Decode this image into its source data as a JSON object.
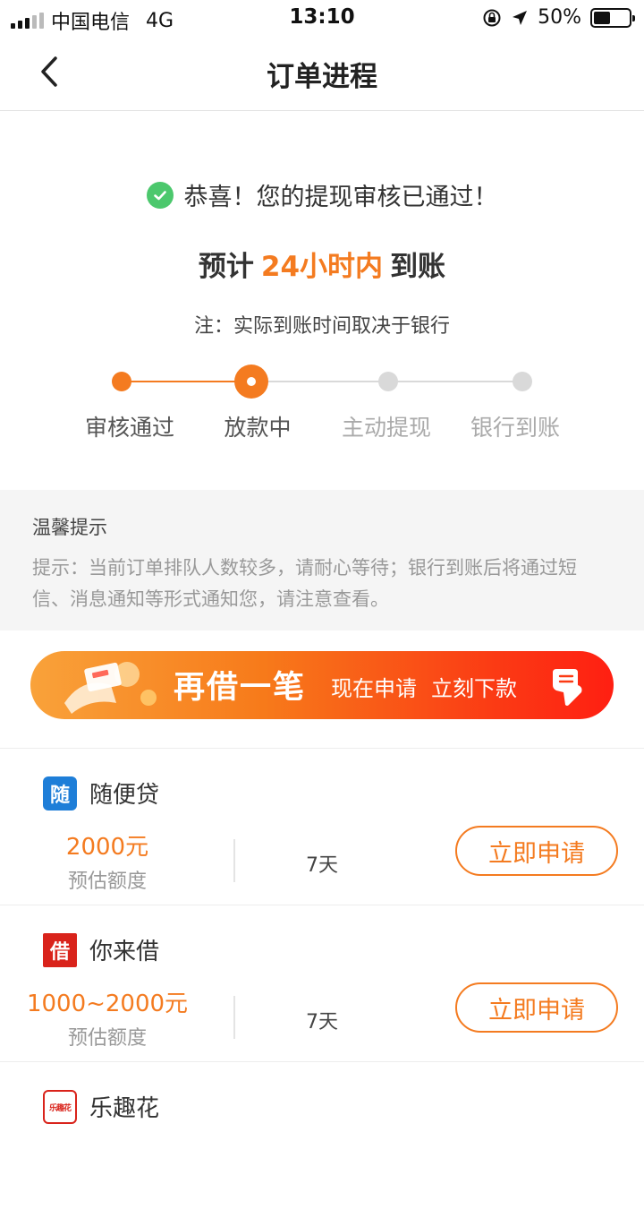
{
  "status_bar": {
    "carrier": "中国电信",
    "network": "4G",
    "time": "13:10",
    "battery": "50%",
    "battery_level": 0.5
  },
  "nav": {
    "title": "订单进程",
    "back_icon": "chevron-left-icon"
  },
  "hero": {
    "success_text": "恭喜！您的提现审核已通过！",
    "eta_prefix": "预计",
    "eta_highlight": "24小时内",
    "eta_suffix": "到账",
    "note": "注：实际到账时间取决于银行"
  },
  "steps": [
    {
      "label": "审核通过",
      "state": "done"
    },
    {
      "label": "放款中",
      "state": "current"
    },
    {
      "label": "主动提现",
      "state": "pending"
    },
    {
      "label": "银行到账",
      "state": "pending"
    }
  ],
  "tips": {
    "title": "温馨提示",
    "body": "提示：当前订单排队人数较多，请耐心等待；银行到账后将通过短信、消息通知等形式通知您，请注意查看。"
  },
  "banner": {
    "main": "再借一笔",
    "sub1": "现在申请",
    "sub2": "立刻下款"
  },
  "products": [
    {
      "name": "随便贷",
      "logo_char": "随",
      "logo_color": "#1e7ed8",
      "amount": "2000元",
      "amount_label": "预估额度",
      "term": "7天",
      "button": "立即申请"
    },
    {
      "name": "你来借",
      "logo_char": "借",
      "logo_color": "#d9231b",
      "amount": "1000~2000元",
      "amount_label": "预估额度",
      "term": "7天",
      "button": "立即申请"
    },
    {
      "name": "乐趣花",
      "logo_char": "乐趣花",
      "logo_color": "#d9231b",
      "amount": "",
      "amount_label": "",
      "term": "",
      "button": ""
    }
  ],
  "colors": {
    "accent": "#f47b20",
    "success": "#4cc86d",
    "step_inactive": "#d9d9d9"
  }
}
